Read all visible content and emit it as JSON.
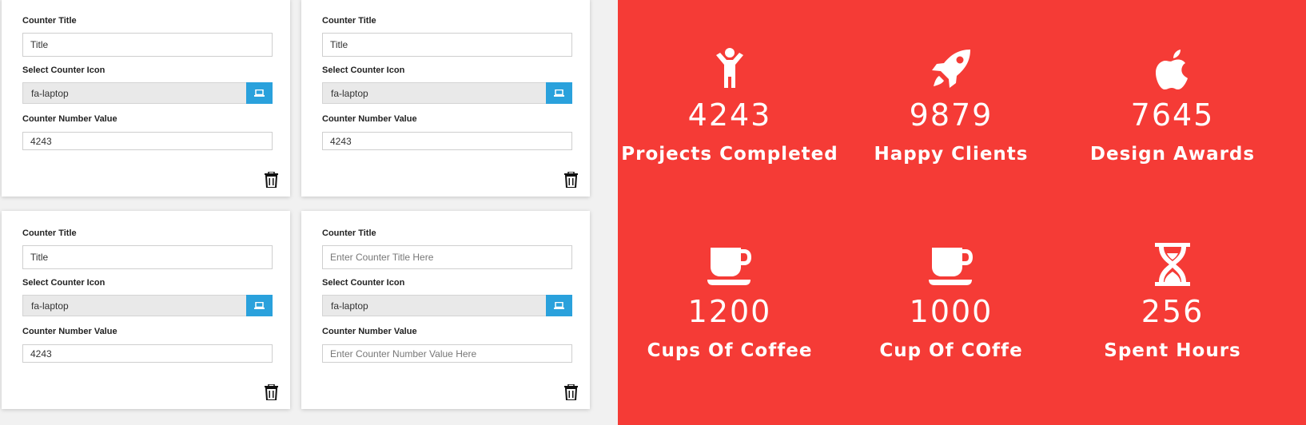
{
  "editor": {
    "labels": {
      "title": "Counter Title",
      "icon": "Select Counter Icon",
      "number": "Counter Number Value"
    },
    "placeholders": {
      "title": "Enter Counter Title Here",
      "number": "Enter Counter Number Value Here"
    },
    "cards": [
      {
        "title": "Title",
        "icon": "fa-laptop",
        "number": "4243"
      },
      {
        "title": "Title",
        "icon": "fa-laptop",
        "number": "4243"
      },
      {
        "title": "Title",
        "icon": "fa-laptop",
        "number": "4243"
      },
      {
        "title": "",
        "icon": "fa-laptop",
        "number": ""
      }
    ],
    "icon_button_icon": "laptop-icon",
    "delete_icon": "trash-icon",
    "accent_color": "#2aa1dc"
  },
  "counters": {
    "background_color": "#f53b36",
    "items": [
      {
        "icon": "child-icon",
        "value": "4243",
        "label": "Projects Completed"
      },
      {
        "icon": "rocket-icon",
        "value": "9879",
        "label": "Happy Clients"
      },
      {
        "icon": "apple-icon",
        "value": "7645",
        "label": "Design Awards"
      },
      {
        "icon": "coffee-icon",
        "value": "1200",
        "label": "Cups Of Coffee"
      },
      {
        "icon": "coffee-icon",
        "value": "1000",
        "label": "Cup Of COffe"
      },
      {
        "icon": "hourglass-icon",
        "value": "256",
        "label": "Spent Hours"
      }
    ]
  }
}
